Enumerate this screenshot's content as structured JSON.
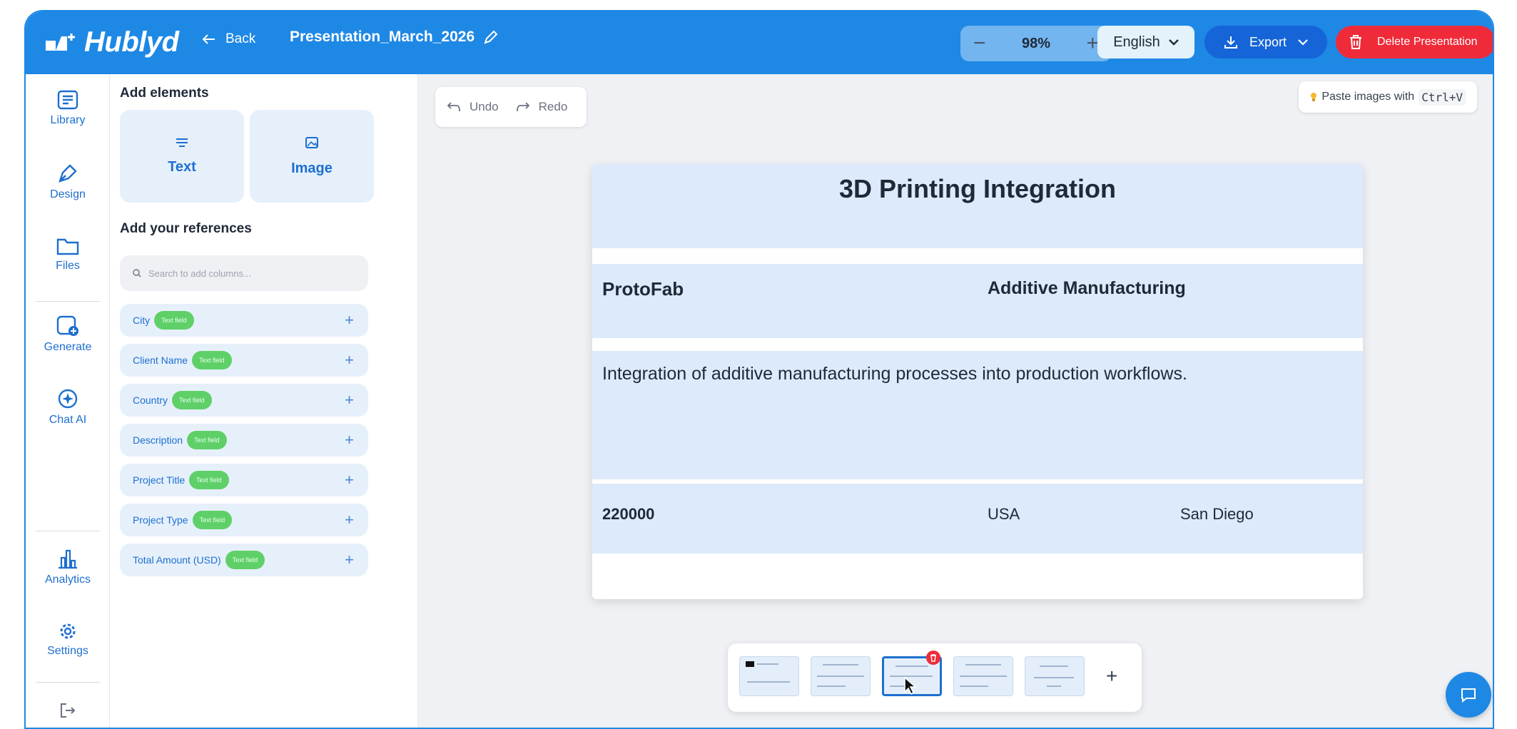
{
  "brand": {
    "name": "Hublyd"
  },
  "header": {
    "back_label": "Back",
    "presentation_title": "Presentation_March_2026",
    "zoom": "98%",
    "language": "English",
    "export_label": "Export",
    "delete_label": "Delete Presentation"
  },
  "nav": {
    "library": "Library",
    "design": "Design",
    "files": "Files",
    "generate": "Generate",
    "chat_ai": "Chat AI",
    "analytics": "Analytics",
    "settings": "Settings"
  },
  "panel": {
    "add_elements": "Add elements",
    "text_tile": "Text",
    "image_tile": "Image",
    "references_heading": "Add your references",
    "search_placeholder": "Search to add columns...",
    "references": [
      {
        "label": "City",
        "tag": "Text field"
      },
      {
        "label": "Client Name",
        "tag": "Text field"
      },
      {
        "label": "Country",
        "tag": "Text field"
      },
      {
        "label": "Description",
        "tag": "Text field"
      },
      {
        "label": "Project Title",
        "tag": "Text field"
      },
      {
        "label": "Project Type",
        "tag": "Text field"
      },
      {
        "label": "Total Amount (USD)",
        "tag": "Text field"
      }
    ]
  },
  "toolbar": {
    "undo": "Undo",
    "redo": "Redo",
    "paste_hint": "Paste images with",
    "paste_shortcut": "Ctrl+V"
  },
  "slide": {
    "title": "3D Printing Integration",
    "client": "ProtoFab",
    "type": "Additive Manufacturing",
    "description": "Integration of additive manufacturing processes into production workflows.",
    "amount": "220000",
    "country": "USA",
    "city": "San Diego"
  },
  "thumbnails": {
    "count": 5,
    "selected_index": 2
  },
  "colors": {
    "primary": "#1e88e5",
    "danger": "#ef2b3a",
    "tag": "#5fd068",
    "accent_text": "#1e6fcf"
  }
}
